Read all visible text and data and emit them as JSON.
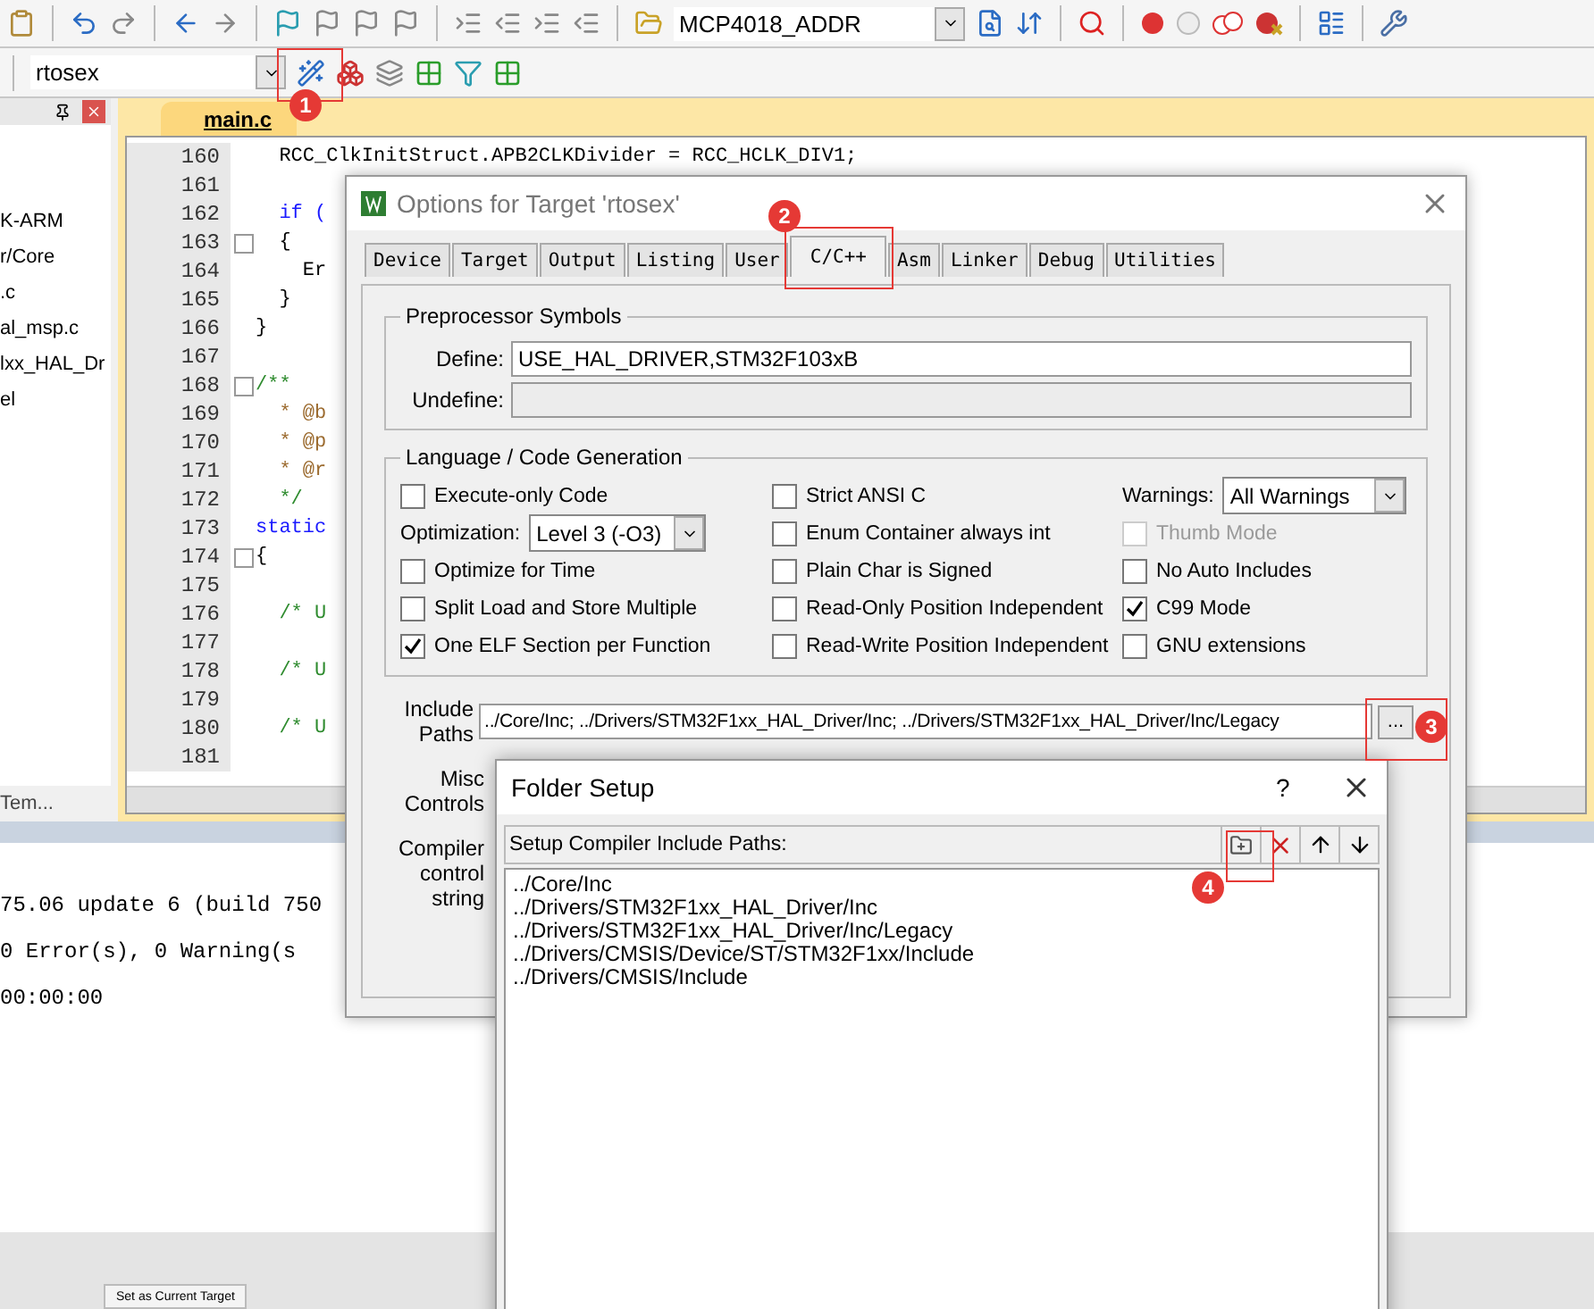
{
  "toolbar": {
    "target": "MCP4018_ADDR",
    "project": "rtosex"
  },
  "project_panel": {
    "items": [
      "K-ARM",
      "r/Core",
      ".c",
      "al_msp.c",
      "lxx_HAL_Dr",
      "el"
    ],
    "tab": "Tem..."
  },
  "editor": {
    "tab": "main.c",
    "lines": [
      {
        "number": "160",
        "code": "  RCC_ClkInitStruct.APB2CLKDivider = RCC_HCLK_DIV1;",
        "kind": "plain",
        "fold": false
      },
      {
        "number": "161",
        "fold": false
      },
      {
        "number": "162",
        "code": "  if (",
        "kind": "keyword",
        "fold": false
      },
      {
        "number": "163",
        "code": "  {",
        "kind": "plain",
        "fold": true
      },
      {
        "number": "164",
        "code": "    Er",
        "kind": "plain",
        "fold": false
      },
      {
        "number": "165",
        "code": "  }",
        "kind": "plain",
        "fold": false
      },
      {
        "number": "166",
        "code": "}",
        "kind": "plain",
        "fold": false
      },
      {
        "number": "167",
        "fold": false
      },
      {
        "number": "168",
        "code": "/**",
        "kind": "comment",
        "fold": true
      },
      {
        "number": "169",
        "code": "  * @b",
        "kind": "doc",
        "fold": false
      },
      {
        "number": "170",
        "code": "  * @p",
        "kind": "doc",
        "fold": false
      },
      {
        "number": "171",
        "code": "  * @r",
        "kind": "doc",
        "fold": false
      },
      {
        "number": "172",
        "code": "  */",
        "kind": "comment",
        "fold": false
      },
      {
        "number": "173",
        "code": "static",
        "kind": "keyword",
        "fold": false
      },
      {
        "number": "174",
        "code": "{",
        "kind": "plain",
        "fold": true
      },
      {
        "number": "175",
        "fold": false
      },
      {
        "number": "176",
        "code": "  /* U",
        "kind": "comment",
        "fold": false
      },
      {
        "number": "177",
        "fold": false
      },
      {
        "number": "178",
        "code": "  /* U",
        "kind": "comment",
        "fold": false
      },
      {
        "number": "179",
        "fold": false
      },
      {
        "number": "180",
        "code": "  /* U",
        "kind": "comment",
        "fold": false
      },
      {
        "number": "181",
        "fold": false
      }
    ]
  },
  "output": {
    "lines": [
      "75.06 update 6 (build 750",
      "0 Error(s), 0 Warning(s",
      "00:00:00"
    ]
  },
  "bottom_bar": {
    "button": "Set as Current Target"
  },
  "options_dialog": {
    "title": "Options for Target 'rtosex'",
    "tabs": [
      {
        "label": "Device",
        "selected": false
      },
      {
        "label": "Target",
        "selected": false
      },
      {
        "label": "Output",
        "selected": false
      },
      {
        "label": "Listing",
        "selected": false
      },
      {
        "label": "User",
        "selected": false
      },
      {
        "label": "C/C++",
        "selected": true
      },
      {
        "label": "Asm",
        "selected": false
      },
      {
        "label": "Linker",
        "selected": false
      },
      {
        "label": "Debug",
        "selected": false
      },
      {
        "label": "Utilities",
        "selected": false
      }
    ],
    "preprocessor": {
      "title": "Preprocessor Symbols",
      "define_label": "Define:",
      "define_value": "USE_HAL_DRIVER,STM32F103xB",
      "undefine_label": "Undefine:"
    },
    "language": {
      "title": "Language / Code Generation",
      "columns": [
        [
          {
            "kind": "checkbox",
            "label": "Execute-only Code",
            "checked": false,
            "disabled": false
          },
          {
            "kind": "select",
            "label": "Optimization:",
            "value": "Level 3 (-O3)"
          },
          {
            "kind": "checkbox",
            "label": "Optimize for Time",
            "checked": false,
            "disabled": false
          },
          {
            "kind": "checkbox",
            "label": "Split Load and Store Multiple",
            "checked": false,
            "disabled": false
          },
          {
            "kind": "checkbox",
            "label": "One ELF Section per Function",
            "checked": true,
            "disabled": false
          }
        ],
        [
          {
            "kind": "checkbox",
            "label": "Strict ANSI C",
            "checked": false,
            "disabled": false
          },
          {
            "kind": "checkbox",
            "label": "Enum Container always int",
            "checked": false,
            "disabled": false
          },
          {
            "kind": "checkbox",
            "label": "Plain Char is Signed",
            "checked": false,
            "disabled": false
          },
          {
            "kind": "checkbox",
            "label": "Read-Only Position Independent",
            "checked": false,
            "disabled": false
          },
          {
            "kind": "checkbox",
            "label": "Read-Write Position Independent",
            "checked": false,
            "disabled": false
          }
        ],
        [
          {
            "kind": "select",
            "label": "Warnings:",
            "value": "All Warnings"
          },
          {
            "kind": "checkbox",
            "label": "Thumb Mode",
            "checked": false,
            "disabled": true
          },
          {
            "kind": "checkbox",
            "label": "No Auto Includes",
            "checked": false,
            "disabled": false
          },
          {
            "kind": "checkbox",
            "label": "C99 Mode",
            "checked": true,
            "disabled": false
          },
          {
            "kind": "checkbox",
            "label": "GNU extensions",
            "checked": false,
            "disabled": false
          }
        ]
      ]
    },
    "include_paths": {
      "label": "Include Paths",
      "value": "../Core/Inc; ../Drivers/STM32F1xx_HAL_Driver/Inc; ../Drivers/STM32F1xx_HAL_Driver/Inc/Legacy",
      "button": "..."
    },
    "misc_label": "Misc Controls",
    "compiler_label": "Compiler control string"
  },
  "folder_setup": {
    "title": "Folder Setup",
    "help": "?",
    "header": "Setup Compiler Include Paths:",
    "paths": [
      "../Core/Inc",
      "../Drivers/STM32F1xx_HAL_Driver/Inc",
      "../Drivers/STM32F1xx_HAL_Driver/Inc/Legacy",
      "../Drivers/CMSIS/Device/ST/STM32F1xx/Include",
      "../Drivers/CMSIS/Include"
    ]
  },
  "annotations": [
    "1",
    "2",
    "3",
    "4"
  ]
}
